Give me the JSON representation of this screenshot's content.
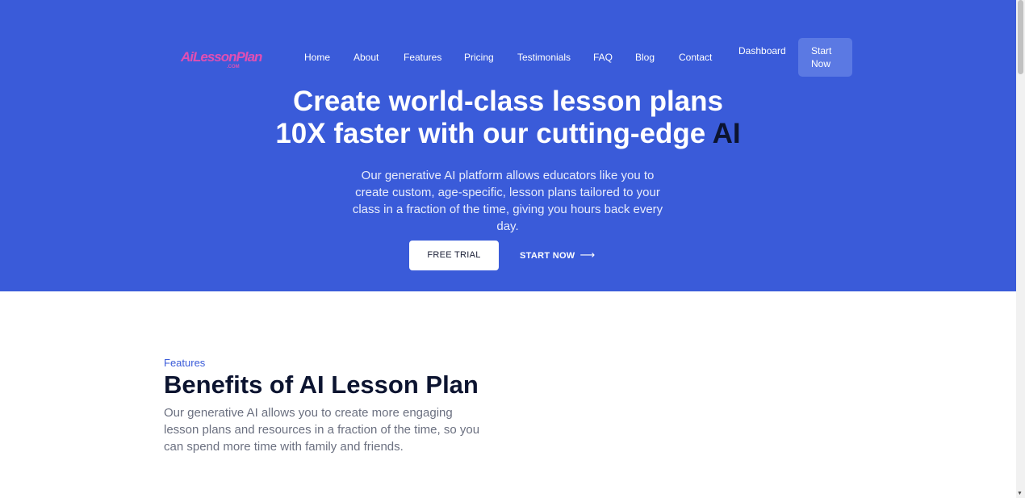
{
  "brand": {
    "logo_text": "AiLessonPlan",
    "logo_subtext": ".COM"
  },
  "nav": {
    "items": [
      {
        "label": "Home"
      },
      {
        "label": "About"
      },
      {
        "label": "Features"
      },
      {
        "label": "Pricing"
      },
      {
        "label": "Testimonials"
      },
      {
        "label": "FAQ"
      },
      {
        "label": "Blog"
      },
      {
        "label": "Contact"
      }
    ],
    "dashboard_label": "Dashboard",
    "start_line1": "Start",
    "start_line2": "Now"
  },
  "hero": {
    "headline_line1": "Create world-class lesson plans",
    "headline_line2_main": "10X faster with our cutting-edge",
    "headline_line2_accent": "AI",
    "lead": "Our generative AI platform allows educators like you to create custom, age-specific, lesson plans tailored to your class in a fraction of the time, giving you hours back every day.",
    "free_trial_label": "FREE TRIAL",
    "start_now_label": "START NOW",
    "arrow_icon": "⟶"
  },
  "features": {
    "eyebrow": "Features",
    "title": "Benefits of AI Lesson Plan",
    "description": "Our generative AI allows you to create more engaging lesson plans and resources in a fraction of the time, so you can spend more time with family and friends."
  },
  "colors": {
    "hero_bg": "#3a5bd9",
    "accent_dark": "#0c1430",
    "logo_pink": "#e04fb3"
  },
  "scrollbar": {
    "down_arrow": "▼"
  }
}
